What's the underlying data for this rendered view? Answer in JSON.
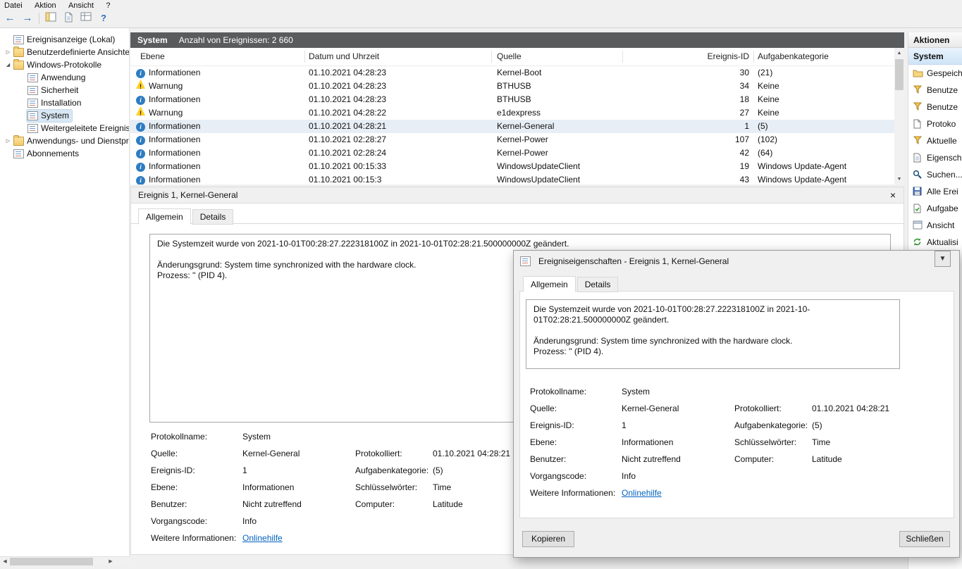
{
  "menubar": {
    "items": [
      "Datei",
      "Aktion",
      "Ansicht",
      "?"
    ]
  },
  "toolbar": {
    "back_glyph": "←",
    "forward_glyph": "→",
    "help_glyph": "?"
  },
  "glyphs": {
    "close": "×",
    "up": "▲",
    "down": "▼",
    "left": "◀",
    "right": "▶"
  },
  "tree": {
    "items": [
      {
        "label": "Ereignisanzeige (Lokal)",
        "twisty": ""
      },
      {
        "label": "Benutzerdefinierte Ansichten",
        "twisty": "▷"
      },
      {
        "label": "Windows-Protokolle",
        "twisty": "◢"
      },
      {
        "label": "Anwendung",
        "twisty": ""
      },
      {
        "label": "Sicherheit",
        "twisty": ""
      },
      {
        "label": "Installation",
        "twisty": ""
      },
      {
        "label": "System",
        "twisty": ""
      },
      {
        "label": "Weitergeleitete Ereignisse",
        "twisty": ""
      },
      {
        "label": "Anwendungs- und Dienstpro",
        "twisty": "▷"
      },
      {
        "label": "Abonnements",
        "twisty": ""
      }
    ]
  },
  "list": {
    "title": "System",
    "count": "Anzahl von Ereignissen: 2 660",
    "columns": [
      "Ebene",
      "Datum und Uhrzeit",
      "Quelle",
      "Ereignis-ID",
      "Aufgabenkategorie"
    ],
    "rows": [
      {
        "level": "Informationen",
        "datetime": "01.10.2021 04:28:23",
        "source": "Kernel-Boot",
        "id": "30",
        "category": "(21)"
      },
      {
        "level": "Warnung",
        "datetime": "01.10.2021 04:28:23",
        "source": "BTHUSB",
        "id": "34",
        "category": "Keine"
      },
      {
        "level": "Informationen",
        "datetime": "01.10.2021 04:28:23",
        "source": "BTHUSB",
        "id": "18",
        "category": "Keine"
      },
      {
        "level": "Warnung",
        "datetime": "01.10.2021 04:28:22",
        "source": "e1dexpress",
        "id": "27",
        "category": "Keine"
      },
      {
        "level": "Informationen",
        "datetime": "01.10.2021 04:28:21",
        "source": "Kernel-General",
        "id": "1",
        "category": "(5)"
      },
      {
        "level": "Informationen",
        "datetime": "01.10.2021 02:28:27",
        "source": "Kernel-Power",
        "id": "107",
        "category": "(102)"
      },
      {
        "level": "Informationen",
        "datetime": "01.10.2021 02:28:24",
        "source": "Kernel-Power",
        "id": "42",
        "category": "(64)"
      },
      {
        "level": "Informationen",
        "datetime": "01.10.2021 00:15:33",
        "source": "WindowsUpdateClient",
        "id": "19",
        "category": "Windows Update-Agent"
      },
      {
        "level": "Informationen",
        "datetime": "01.10.2021 00:15:3",
        "source": "WindowsUpdateClient",
        "id": "43",
        "category": "Windows Update-Agent"
      }
    ]
  },
  "event": {
    "preview_title": "Ereignis 1, Kernel-General",
    "tab_general": "Allgemein",
    "tab_details": "Details",
    "description": {
      "line1": "Die Systemzeit wurde von 2021-10-01T00:28:27.222318100Z in 2021-10-01T02:28:21.500000000Z geändert.",
      "line2": "Änderungsgrund: System time synchronized with the hardware clock.",
      "line3": "Prozess: '' (PID 4)."
    },
    "fields": [
      {
        "l1": "Protokollname:",
        "v1": "System",
        "l2": "",
        "v2": ""
      },
      {
        "l1": "Quelle:",
        "v1": "Kernel-General",
        "l2": "Protokolliert:",
        "v2": "01.10.2021 04:28:21"
      },
      {
        "l1": "Ereignis-ID:",
        "v1": "1",
        "l2": "Aufgabenkategorie:",
        "v2": "(5)"
      },
      {
        "l1": "Ebene:",
        "v1": "Informationen",
        "l2": "Schlüsselwörter:",
        "v2": "Time"
      },
      {
        "l1": "Benutzer:",
        "v1": "Nicht zutreffend",
        "l2": "Computer:",
        "v2": "Latitude"
      },
      {
        "l1": "Vorgangscode:",
        "v1": "Info",
        "l2": "",
        "v2": ""
      },
      {
        "l1": "Weitere Informationen:",
        "v1": "Onlinehilfe",
        "l2": "",
        "v2": ""
      }
    ]
  },
  "dialog": {
    "title": "Ereigniseigenschaften - Ereignis 1, Kernel-General",
    "copy_button": "Kopieren",
    "close_button": "Schließen"
  },
  "actions": {
    "title": "Aktionen",
    "group": "System",
    "items": [
      {
        "label": "Gespeich"
      },
      {
        "label": "Benutze"
      },
      {
        "label": "Benutze"
      },
      {
        "label": "Protoko"
      },
      {
        "label": "Aktuelle"
      },
      {
        "label": "Eigensch"
      },
      {
        "label": "Suchen..."
      },
      {
        "label": "Alle Erei"
      },
      {
        "label": "Aufgabe"
      },
      {
        "label": "Ansicht"
      },
      {
        "label": "Aktualisi"
      }
    ]
  }
}
